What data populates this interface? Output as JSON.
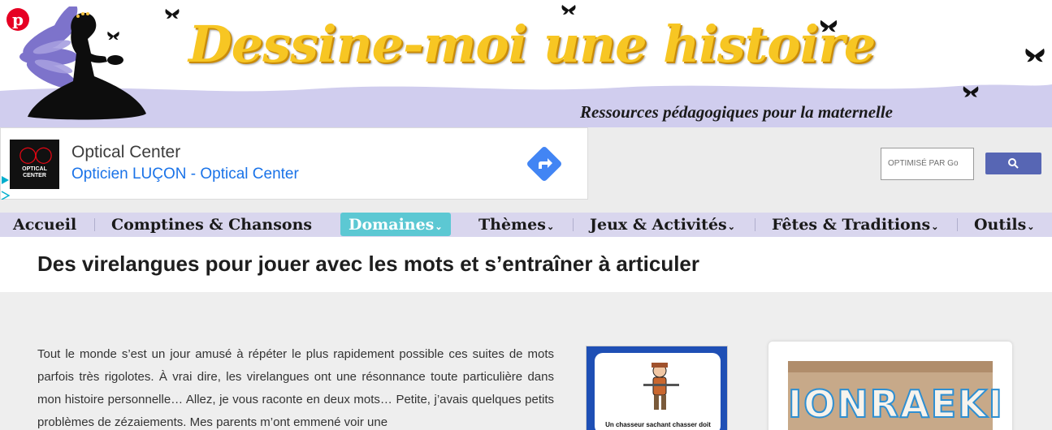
{
  "header": {
    "site_title": "Dessine-moi une histoire",
    "tagline": "Ressources pédagogiques pour la maternelle",
    "pinterest_icon": "pinterest-icon"
  },
  "ad": {
    "logo_text": "OPTICAL CENTER",
    "title": "Optical Center",
    "subtitle": "Opticien LUÇON - Optical Center",
    "direction_icon": "directions-icon"
  },
  "search": {
    "placeholder": "OPTIMISÉ PAR Go",
    "button_icon": "search-icon"
  },
  "nav": {
    "items": [
      {
        "label": "Accueil",
        "chevron": ""
      },
      {
        "label": "Comptines & Chansons",
        "chevron": ""
      },
      {
        "label": "Domaines",
        "chevron": "⌄"
      },
      {
        "label": "Thèmes",
        "chevron": "⌄"
      },
      {
        "label": "Jeux & Activités",
        "chevron": "⌄"
      },
      {
        "label": "Fêtes & Traditions",
        "chevron": "⌄"
      },
      {
        "label": "Outils",
        "chevron": "⌄"
      }
    ]
  },
  "post": {
    "title": "Des virelangues pour jouer avec les mots et s’entraîner à articuler",
    "intro": "Tout le monde s’est un jour amusé à répéter le plus rapidement possible ces suites de mots parfois très rigolotes. À vrai dire, les virelangues ont une résonnance toute particulière dans mon histoire personnelle… Allez, je vous raconte en deux mots… Petite, j’avais quelques petits problèmes de zézaiements. Mes parents m’ont emmené voir une",
    "card_caption": "Un chasseur sachant chasser doit savoir chasser sans son chien.",
    "box_letters": "IONRAEKI"
  },
  "colors": {
    "accent": "#5cc8d3",
    "nav_bg": "#d9d6ee",
    "title_yellow": "#f7c623",
    "search_button": "#5766b4",
    "link_blue": "#1a73e8"
  }
}
